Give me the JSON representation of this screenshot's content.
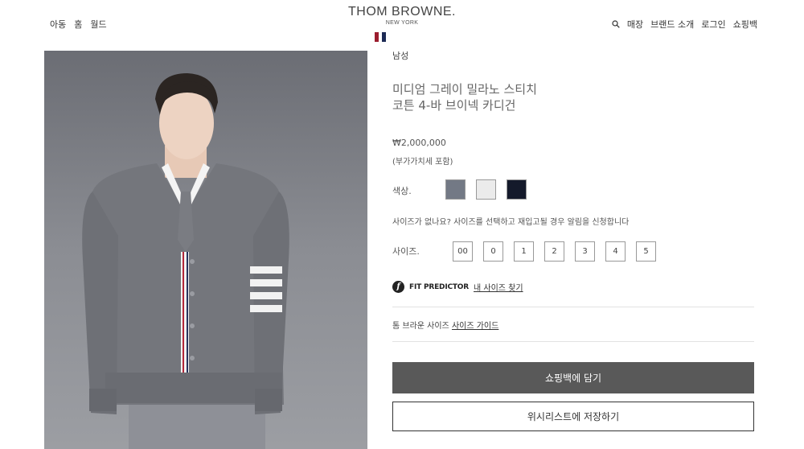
{
  "header": {
    "nav_left": [
      "아동",
      "홈",
      "월드"
    ],
    "logo_main": "THOM BROWNE.",
    "logo_sub": "NEW YORK",
    "flag_colors": [
      "#9b1c2e",
      "#ffffff",
      "#1c2a55"
    ],
    "search_icon": "search-icon",
    "nav_right": [
      "매장",
      "브랜드 소개",
      "로그인",
      "쇼핑백"
    ]
  },
  "product": {
    "category": "남성",
    "title_line1": "미디엄 그레이 밀라노 스티치",
    "title_line2": "코튼 4-바 브이넥 카디건",
    "price": "₩2,000,000",
    "vat_note": "(부가가치세 포함)",
    "color_label": "색상.",
    "colors": [
      "#737985",
      "#ebebeb",
      "#141a2b"
    ],
    "restock_notice": "사이즈가 없나요? 사이즈를 선택하고 재입고될 경우 알림을 신청합니다",
    "size_label": "사이즈.",
    "sizes": [
      "00",
      "0",
      "1",
      "2",
      "3",
      "4",
      "5"
    ],
    "fit_predictor": {
      "logo": "f",
      "brand": "FIT PREDICTOR",
      "link": "내 사이즈 찾기"
    },
    "size_guide_prefix": "톰 브라운 사이즈",
    "size_guide_link": "사이즈 가이드",
    "add_to_cart": "쇼핑백에 담기",
    "wishlist": "위시리스트에 저장하기"
  }
}
